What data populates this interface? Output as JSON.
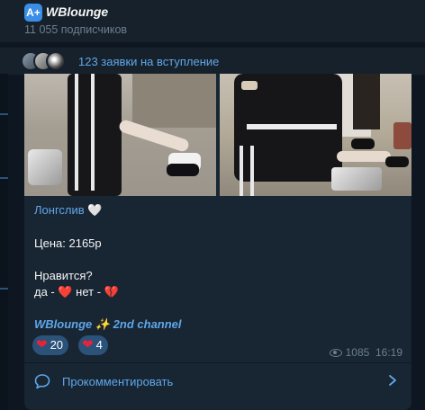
{
  "channel": {
    "logo_text": "A+",
    "title": "WBlounge",
    "subscribers": "11 055 подписчиков"
  },
  "join_requests": {
    "text": "123 заявки на вступление"
  },
  "post": {
    "title": "Лонгслив 🤍",
    "price": "Цена: 2165р",
    "question": "Нравится?",
    "vote_line": "да - ❤️ нет - 💔",
    "signature": "WBlounge ✨ 2nd channel"
  },
  "reactions": [
    {
      "emoji": "❤",
      "count": "20"
    },
    {
      "emoji": "❤",
      "count": "4"
    }
  ],
  "meta": {
    "views": "1085",
    "time": "16:19"
  },
  "comment": {
    "label": "Прокомментировать"
  },
  "colors": {
    "background": "#0e1621",
    "bubble": "#182533",
    "accent": "#5fa7e8",
    "reaction_bg": "#2b5278"
  }
}
